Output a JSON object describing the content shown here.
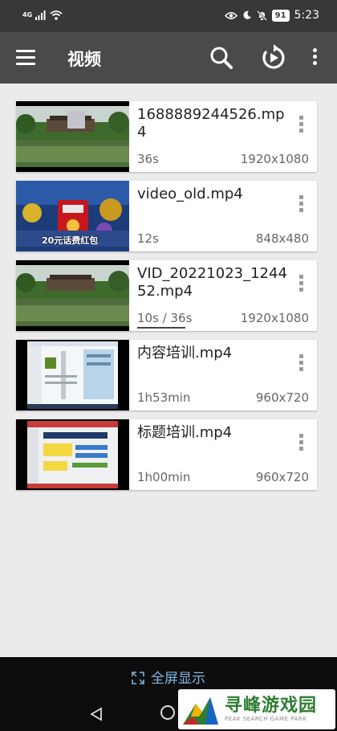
{
  "status_bar": {
    "network": "4G",
    "time": "5:23",
    "battery": "91"
  },
  "app_bar": {
    "title": "视频"
  },
  "videos": [
    {
      "name": "1688889244526.mp4",
      "duration": "36s",
      "resolution": "1920x1080",
      "thumb": "landscape"
    },
    {
      "name": "video_old.mp4",
      "duration": "12s",
      "resolution": "848x480",
      "thumb": "game",
      "thumb_caption": "20元话费红包"
    },
    {
      "name": "VID_20221023_124452.mp4",
      "duration": "10s / 36s",
      "resolution": "1920x1080",
      "thumb": "landscape",
      "progress": 0.28
    },
    {
      "name": "内容培训.mp4",
      "duration": "1h53min",
      "resolution": "960x720",
      "thumb": "screen"
    },
    {
      "name": "标题培训.mp4",
      "duration": "1h00min",
      "resolution": "960x720",
      "thumb": "slides"
    }
  ],
  "bottom": {
    "fullscreen_label": "全屏显示"
  },
  "watermark": {
    "cn": "寻峰游戏园",
    "en": "PEAK SEARCH GAME PARK"
  },
  "colors": {
    "status_bar": "#383838",
    "app_bar": "#4a4a4a",
    "background": "#ebebeb",
    "accent": "#7fb6e3"
  }
}
